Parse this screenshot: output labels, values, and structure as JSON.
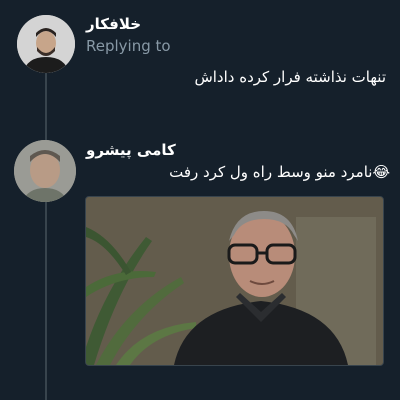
{
  "reply_context": {
    "author_name": "خلافکار",
    "replying_label": "Replying to",
    "text": "تنهات نذاشته فرار کرده داداش"
  },
  "reply": {
    "author_name": "کامی پیشرو",
    "text": "😂نامرد منو وسط راه ول کرد رفت"
  },
  "colors": {
    "background": "#15202b",
    "thread_line": "#38444d",
    "secondary_text": "#8899a6"
  }
}
